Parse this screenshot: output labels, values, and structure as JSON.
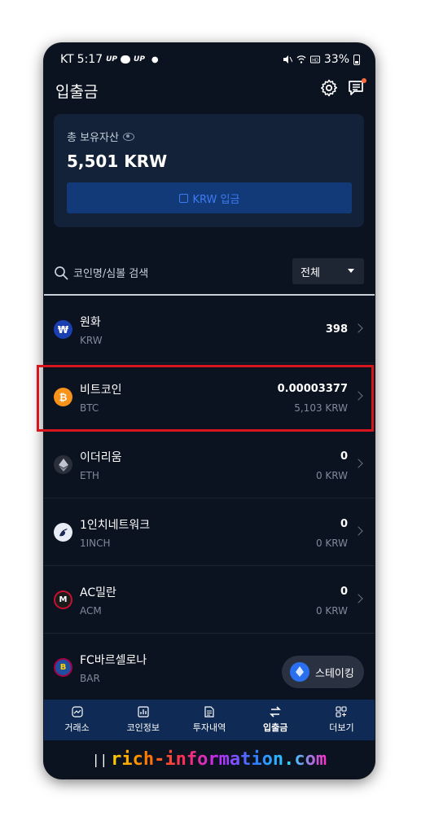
{
  "status_bar": {
    "carrier": "KT",
    "time": "5:17",
    "tag1": "UP",
    "tag2": "UP",
    "battery": "33%"
  },
  "header": {
    "title": "입출금",
    "settings_icon": "gear-icon",
    "notice_icon": "notice-icon"
  },
  "asset": {
    "label": "총 보유자산",
    "value": "5,501 KRW",
    "deposit_label": "KRW 입금"
  },
  "search": {
    "placeholder": "코인명/심볼 검색",
    "filter_value": "전체"
  },
  "coins": [
    {
      "name": "원화",
      "symbol": "KRW",
      "amount": "398",
      "krw": "",
      "logo_color": "#1a3fb0",
      "logo_text": "₩"
    },
    {
      "name": "비트코인",
      "symbol": "BTC",
      "amount": "0.00003377",
      "krw": "5,103 KRW",
      "logo_color": "#f7931a",
      "logo_text": "₿"
    },
    {
      "name": "이더리움",
      "symbol": "ETH",
      "amount": "0",
      "krw": "0 KRW",
      "logo_color": "#2a2f3a",
      "logo_text": "◆"
    },
    {
      "name": "1인치네트워크",
      "symbol": "1INCH",
      "amount": "0",
      "krw": "0 KRW",
      "logo_color": "#e8ecf5",
      "logo_text": "🦄"
    },
    {
      "name": "AC밀란",
      "symbol": "ACM",
      "amount": "0",
      "krw": "0 KRW",
      "logo_color": "#1b1b1b",
      "logo_text": "M"
    },
    {
      "name": "FC바르셀로나",
      "symbol": "BAR",
      "amount": "",
      "krw": "",
      "logo_color": "#1f4fa0",
      "logo_text": "B"
    }
  ],
  "staking": {
    "label": "스테이킹"
  },
  "bottom_nav": {
    "items": [
      {
        "label": "거래소",
        "icon": "exchange-icon"
      },
      {
        "label": "코인정보",
        "icon": "coin-info-icon"
      },
      {
        "label": "투자내역",
        "icon": "history-icon"
      },
      {
        "label": "입출금",
        "icon": "transfer-icon"
      },
      {
        "label": "더보기",
        "icon": "more-icon"
      }
    ],
    "active_index": 3
  },
  "watermark": {
    "text": "rich-information.com"
  },
  "colors": {
    "background": "#0b1220",
    "card": "#132238",
    "accent": "#3d7bf4",
    "highlight": "#d8141c",
    "nav": "#0f2a55"
  }
}
